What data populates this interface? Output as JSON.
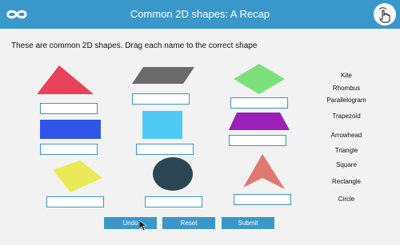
{
  "header": {
    "title": "Common 2D shapes: A Recap",
    "logo_icon": "infinity-icon",
    "action_icon": "hand-touch-icon",
    "bg_color": "#3a97c9"
  },
  "instruction": "These are common 2D shapes. Drag each name to the correct shape",
  "shapes": [
    {
      "kind": "triangle",
      "color": "#e8415a"
    },
    {
      "kind": "parallelogram",
      "color": "#6b6b6b"
    },
    {
      "kind": "rhombus",
      "color": "#7be07a"
    },
    {
      "kind": "rectangle",
      "color": "#2f55e8"
    },
    {
      "kind": "square",
      "color": "#4fcaf5"
    },
    {
      "kind": "trapezoid",
      "color": "#9b1fb8"
    },
    {
      "kind": "kite",
      "color": "#eaea58"
    },
    {
      "kind": "circle",
      "color": "#2c4753"
    },
    {
      "kind": "arrowhead",
      "color": "#e07872"
    }
  ],
  "names": [
    "Kite",
    "Rhombus",
    "Parallelogram",
    "Trapezoid",
    "Arrowhead",
    "Triangle",
    "Square",
    "Rectangle",
    "Circle"
  ],
  "buttons": {
    "undo": "Undo",
    "reset": "Reset",
    "submit": "Submit"
  }
}
